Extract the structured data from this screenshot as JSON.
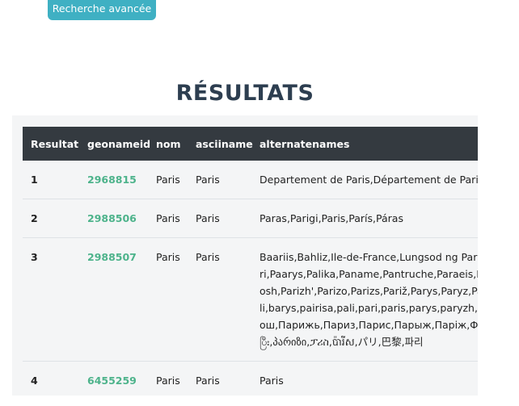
{
  "advanced_search": {
    "label": "Recherche avancée"
  },
  "results": {
    "title": "RÉSULTATS",
    "columns": [
      "Resultat",
      "geonameid",
      "nom",
      "asciiname",
      "alternatenames"
    ],
    "rows": [
      {
        "resultat": "1",
        "geonameid": "2968815",
        "nom": "Paris",
        "asciiname": "Paris",
        "alternatenames": [
          "Departement de Paris,Département de Paris,Pa"
        ]
      },
      {
        "resultat": "2",
        "geonameid": "2988506",
        "nom": "Paris",
        "asciiname": "Paris",
        "alternatenames": [
          "Paras,Parigi,Paris,París,Páras"
        ]
      },
      {
        "resultat": "3",
        "geonameid": "2988507",
        "nom": "Paris",
        "asciiname": "Paris",
        "alternatenames": [
          "Baariis,Bahliz,Ile-de-France,Lungsod ng Paris,Lu",
          "ri,Paarys,Palika,Paname,Pantruche,Paraeis,Para",
          "osh,Parizh',Parizo,Parizs,Pariž,Parys,Paryz,Pary",
          "li,barys,pairisa,pali,pari,paris,parys,paryzh,peris",
          "ош,Парижь,Париз,Парис,Парыж,Паріж,Փար",
          "ပြီး,პარიზი,ፓሪስ,ប៉ារីស,パリ,巴黎,파리"
        ]
      },
      {
        "resultat": "4",
        "geonameid": "6455259",
        "nom": "Paris",
        "asciiname": "Paris",
        "alternatenames": [
          "Paris"
        ]
      }
    ]
  }
}
